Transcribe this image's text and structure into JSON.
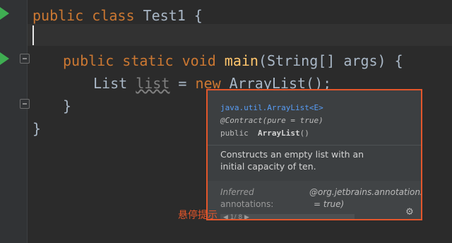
{
  "editor": {
    "lines": {
      "l1_kw": "public class",
      "l1_rest": " Test1 {",
      "l3_kw": "public static void",
      "l3_fn": "main",
      "l3_rest": "(String[] args) {",
      "l4_type": "List ",
      "l4_var": "list",
      "l4_eq": " = ",
      "l4_kw": "new",
      "l4_rest": " ArrayList();",
      "l5": "}",
      "l6": "}"
    }
  },
  "popup": {
    "class_link": "java.util.ArrayList<E>",
    "contract": "@Contract(pure = true)",
    "decl_modifier": "public",
    "decl_name": "ArrayList",
    "decl_parens": "()",
    "description": "Constructs an empty list with an initial capacity of ten.",
    "inferred_label_1": "Inferred",
    "inferred_label_2": "annotations:",
    "inferred_value_1": "@org.jetbrains.annotations.C",
    "inferred_value_2": "= true)",
    "pager": "◀ 1/ 8 ▶"
  },
  "annotation": {
    "hover_hint": "悬停提示"
  },
  "icons": {
    "run": "run-icon",
    "fold": "fold-icon",
    "settings": "gear-icon"
  },
  "colors": {
    "accent_border": "#e3562b",
    "keyword": "#cc7832",
    "function": "#ffc66d",
    "link": "#589df6"
  }
}
